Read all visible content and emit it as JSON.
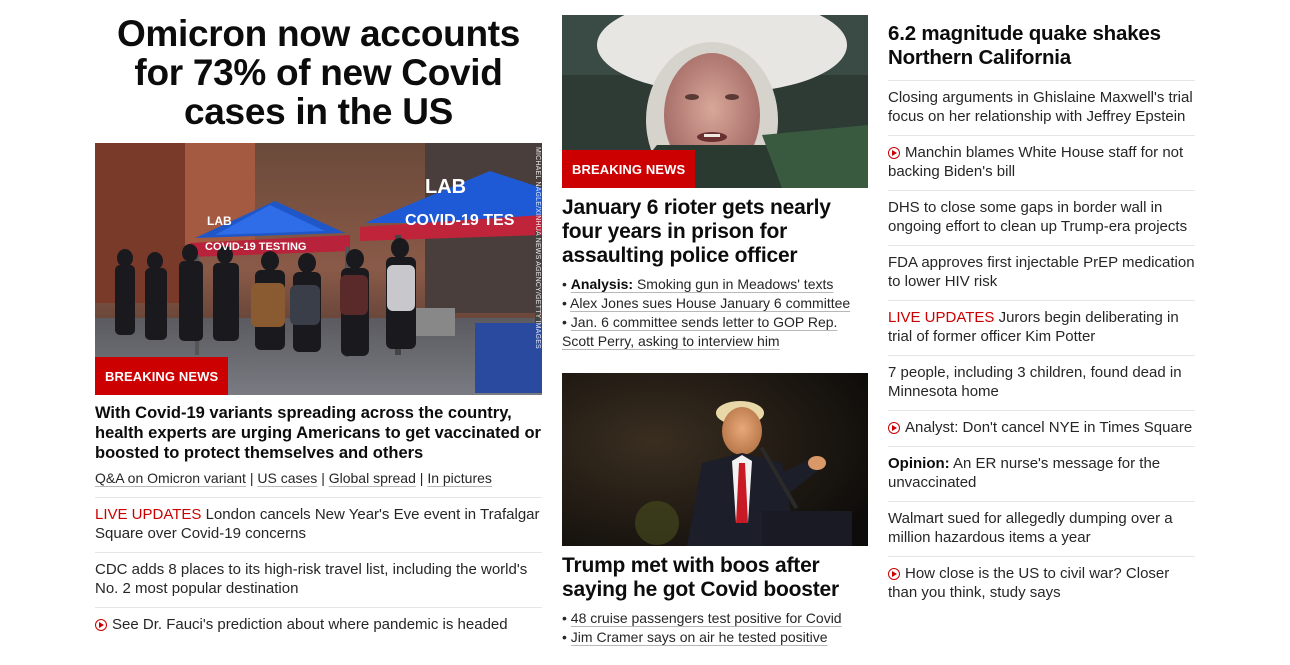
{
  "col1": {
    "hero_title": "Omicron now accounts for 73% of new Covid cases in the US",
    "image": {
      "badge": "BREAKING NEWS",
      "credit": "MICHAEL NAGLE/XINHUA NEWS AGENCY/GETTY IMAGES",
      "tent_text_left": "COVID-19 TESTING",
      "tent_text_right": "COVID-19 TES",
      "tent_logo": "LAB"
    },
    "subheadline": "With Covid-19 variants spreading across the country, health experts are urging Americans to get vaccinated or boosted to protect themselves and others",
    "related_links": [
      "Q&A on Omicron variant",
      "US cases",
      "Global spread",
      "In pictures"
    ],
    "separator": "|",
    "stories": [
      {
        "tag": "LIVE UPDATES",
        "text": "London cancels New Year's Eve event in Trafalgar Square over Covid-19 concerns"
      },
      {
        "text": "CDC adds 8 places to its high-risk travel list, including the world's No. 2 most popular destination"
      },
      {
        "video": true,
        "text": "See Dr. Fauci's prediction about where pandemic is headed"
      }
    ]
  },
  "col2": {
    "top_badge": "BREAKING NEWS",
    "top_headline": "January 6 rioter gets nearly four years in prison for assaulting police officer",
    "bullets": [
      {
        "prefix": "Analysis:",
        "text": "Smoking gun in Meadows' texts"
      },
      {
        "text": "Alex Jones sues House January 6 committee"
      },
      {
        "text": "Jan. 6 committee sends letter to GOP Rep. Scott Perry, asking to interview him"
      }
    ],
    "bullet_char": "•",
    "second_headline": "Trump met with boos after saying he got Covid booster",
    "second_bullets": [
      {
        "text": "48 cruise passengers test positive for Covid"
      },
      {
        "text": "Jim Cramer says on air he tested positive"
      }
    ]
  },
  "col3": {
    "headline": "6.2 magnitude quake shakes Northern California",
    "stories": [
      {
        "text": "Closing arguments in Ghislaine Maxwell's trial focus on her relationship with Jeffrey Epstein"
      },
      {
        "video": true,
        "text": "Manchin blames White House staff for not backing Biden's bill"
      },
      {
        "text": "DHS to close some gaps in border wall in ongoing effort to clean up Trump-era projects"
      },
      {
        "text": "FDA approves first injectable PrEP medication to lower HIV risk"
      },
      {
        "tag": "LIVE UPDATES",
        "text": "Jurors begin deliberating in trial of former officer Kim Potter"
      },
      {
        "text": "7 people, including 3 children, found dead in Minnesota home"
      },
      {
        "video": true,
        "text": "Analyst: Don't cancel NYE in Times Square"
      },
      {
        "prefix": "Opinion:",
        "text": "An ER nurse's message for the unvaccinated"
      },
      {
        "text": "Walmart sued for allegedly dumping over a million hazardous items a year"
      },
      {
        "video": true,
        "text": "How close is the US to civil war? Closer than you think, study says"
      }
    ]
  },
  "colors": {
    "brand_red": "#cc0000",
    "text_dark": "#0c0c0c",
    "text_body": "#262626",
    "divider": "#e6e6e6"
  }
}
